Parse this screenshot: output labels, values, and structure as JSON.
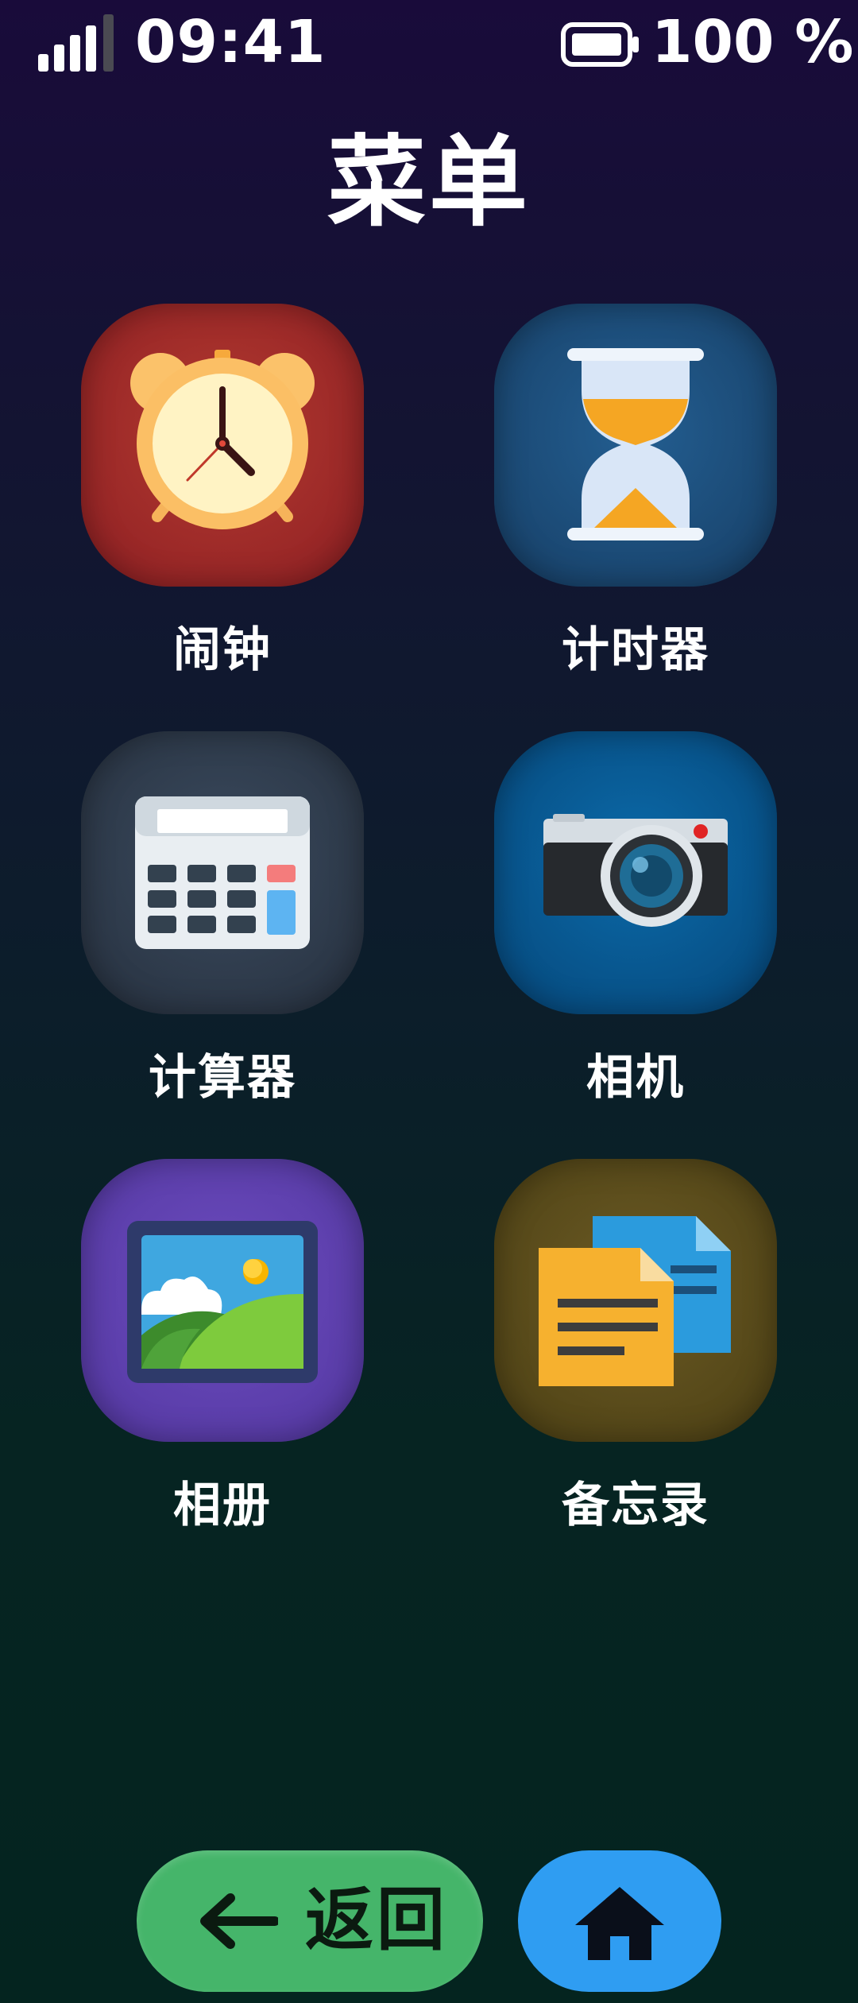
{
  "status_bar": {
    "time": "09:41",
    "battery_level": "100 %",
    "signal_icon": "signal-strength-icon",
    "battery_icon": "battery-icon"
  },
  "title": "菜单",
  "apps": [
    {
      "label": "闹钟",
      "icon": "alarm-clock-icon"
    },
    {
      "label": "计时器",
      "icon": "hourglass-icon"
    },
    {
      "label": "计算器",
      "icon": "calculator-icon"
    },
    {
      "label": "相机",
      "icon": "camera-icon"
    },
    {
      "label": "相册",
      "icon": "photo-gallery-icon"
    },
    {
      "label": "备忘录",
      "icon": "notes-icon"
    }
  ],
  "nav": {
    "back_label": "返回",
    "back_icon": "left-arrow-icon",
    "home_icon": "home-icon"
  },
  "colors": {
    "back_button": "#45b56a",
    "home_button": "#2f9df2",
    "alarm_tile": "#8e1f23",
    "timer_tile": "#173f66",
    "calculator_tile": "#27313f",
    "camera_tile": "#06477a",
    "gallery_tile": "#5438a2",
    "notes_tile": "#4c4014"
  }
}
